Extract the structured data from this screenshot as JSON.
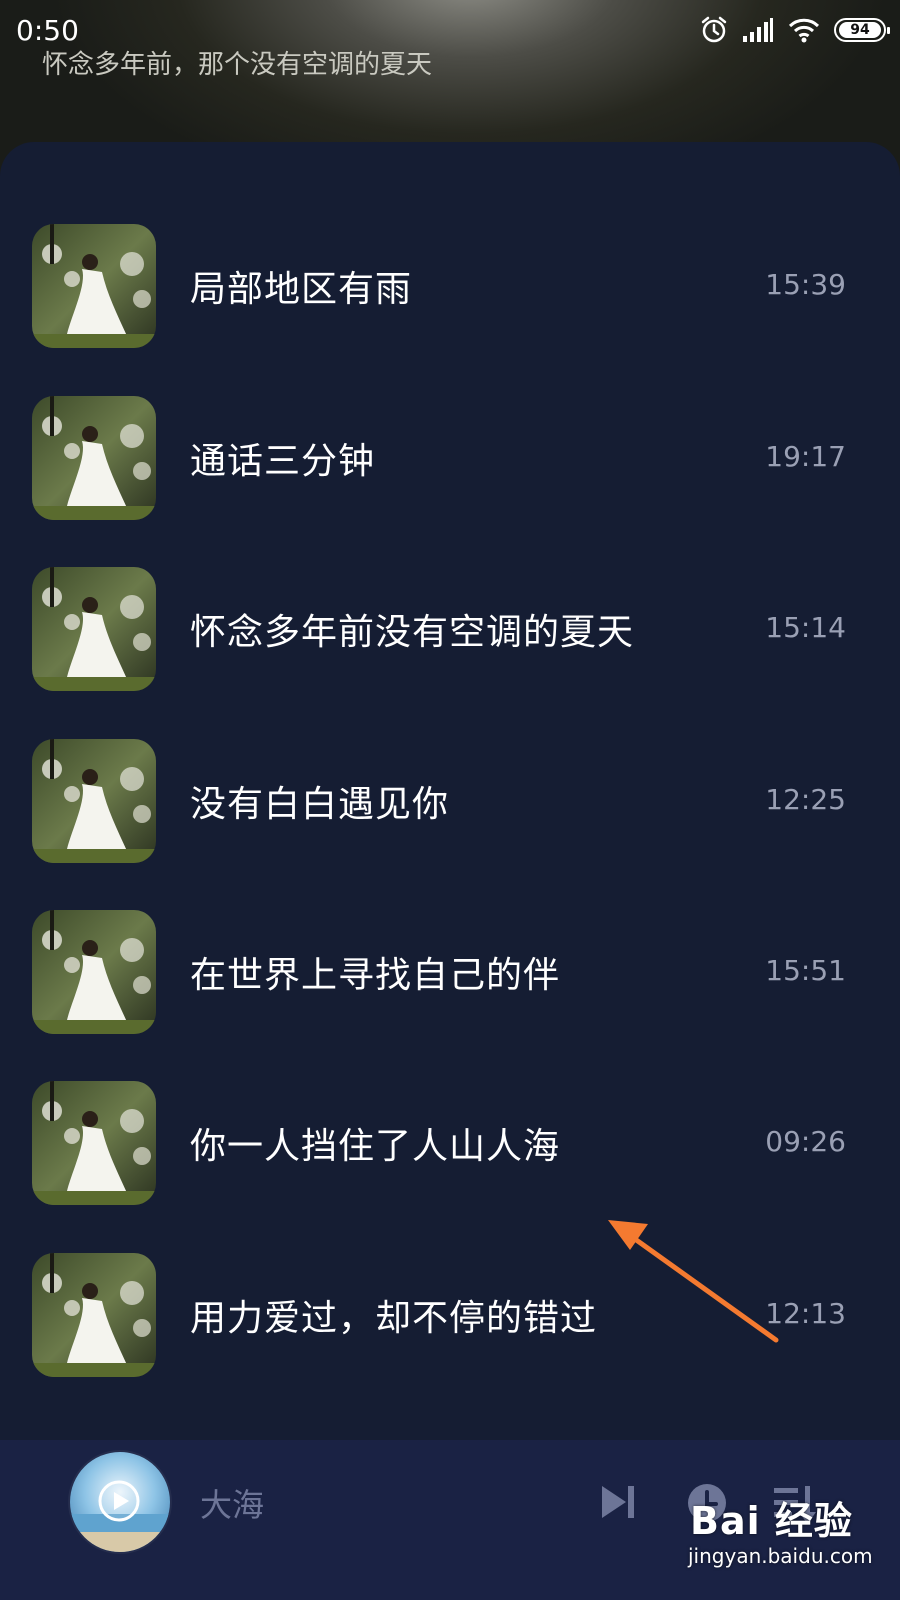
{
  "status_bar": {
    "time": "0:50",
    "battery": "94",
    "icons": [
      "alarm-icon",
      "signal-icon",
      "wifi-icon",
      "battery-icon"
    ]
  },
  "header": {
    "now_playing": "怀念多年前，那个没有空调的夏天"
  },
  "songs": [
    {
      "title": "局部地区有雨",
      "duration": "15:39"
    },
    {
      "title": "通话三分钟",
      "duration": "19:17"
    },
    {
      "title": "怀念多年前没有空调的夏天",
      "duration": "15:14"
    },
    {
      "title": "没有白白遇见你",
      "duration": "12:25"
    },
    {
      "title": "在世界上寻找自己的伴",
      "duration": "15:51"
    },
    {
      "title": "你一人挡住了人山人海",
      "duration": "09:26"
    },
    {
      "title": "用力爱过，却不停的错过",
      "duration": "12:13"
    }
  ],
  "player": {
    "title": "大海",
    "controls": [
      "next-track-icon",
      "timer-icon",
      "playlist-icon"
    ]
  },
  "watermark": {
    "brand": "Bai 经验",
    "url": "jingyan.baidu.com"
  },
  "colors": {
    "background": "#151d33",
    "player_bar": "#1a2244",
    "arrow": "#f47a30",
    "duration_text": "#9aa0b4"
  }
}
